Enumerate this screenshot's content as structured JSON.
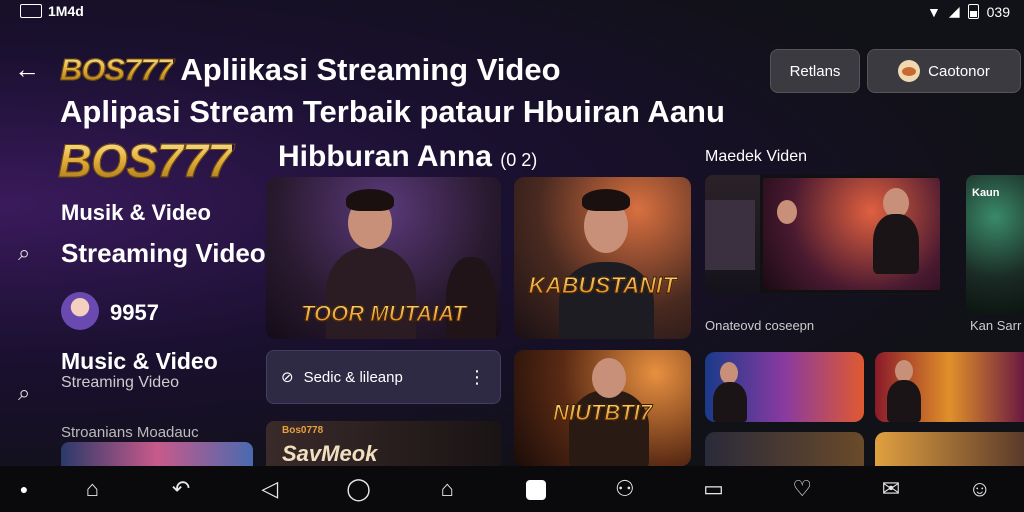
{
  "status_bar": {
    "left_text": "1M4d",
    "time": "039"
  },
  "header": {
    "brand": "BOS777",
    "title_line1": "Apliikasi Streaming Video",
    "title_line2": "Aplipasi Stream Terbaik pataur Hbuiran Aanu",
    "big_logo": "BOS777",
    "subtitle": "Hibburan Anna",
    "subtitle_badge": "(0 2)",
    "buttons": {
      "left": "Retlans",
      "right": "Caotonor"
    }
  },
  "sidebar": {
    "item1": "Musik & Video",
    "item2": "Streaming Video",
    "user_count": "9957",
    "item3_title": "Music & Video",
    "item3_sub": "Streaming Video",
    "section_label": "Stroanians Moadauc"
  },
  "cards": {
    "card1_caption": "TOOR MUTAIAT",
    "card2_caption": "KABUSTANIT",
    "card3_caption": "NIUTBTI7",
    "option_label": "Sedic & lileanp",
    "section_title": "Maedek Viden",
    "tv_caption": "Onateovd coseepn",
    "side_card_label": "Kan Sarr",
    "side_card_top": "Kaun",
    "bottom_card_top": "Bos0778",
    "bottom_card_text": "SavMeok"
  },
  "colors": {
    "brand_gold": "#e8b340",
    "accent_purple": "#3a1a5c",
    "nav_bg": "#0a0a0c"
  }
}
